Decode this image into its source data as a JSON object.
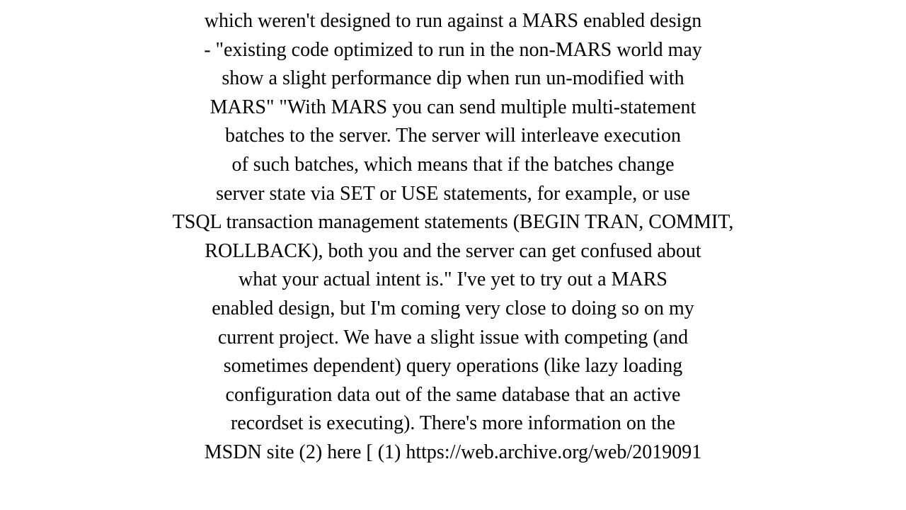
{
  "content": {
    "lines": [
      "which weren't designed to run against a MARS enabled design",
      "- \"existing code optimized to run in the non-MARS world may",
      "show a slight performance dip when run un-modified with",
      "MARS\"  \"With MARS you can send multiple multi-statement",
      "batches to the server. The server will interleave execution",
      "of such batches, which means that if the batches change",
      "server state via SET or USE statements, for example, or use",
      "TSQL transaction management statements (BEGIN TRAN, COMMIT,",
      "ROLLBACK), both you and the server can get confused about",
      "what your actual intent is.\"   I've yet to try out a MARS",
      "enabled design, but I'm coming very close to doing so on my",
      "current project.  We have a slight issue with competing (and",
      "sometimes dependent) query operations (like lazy loading",
      "configuration data out of the same database that an active",
      "recordset is executing). There's more information on the",
      "MSDN site (2) here [ (1) https://web.archive.org/web/2019091"
    ]
  }
}
